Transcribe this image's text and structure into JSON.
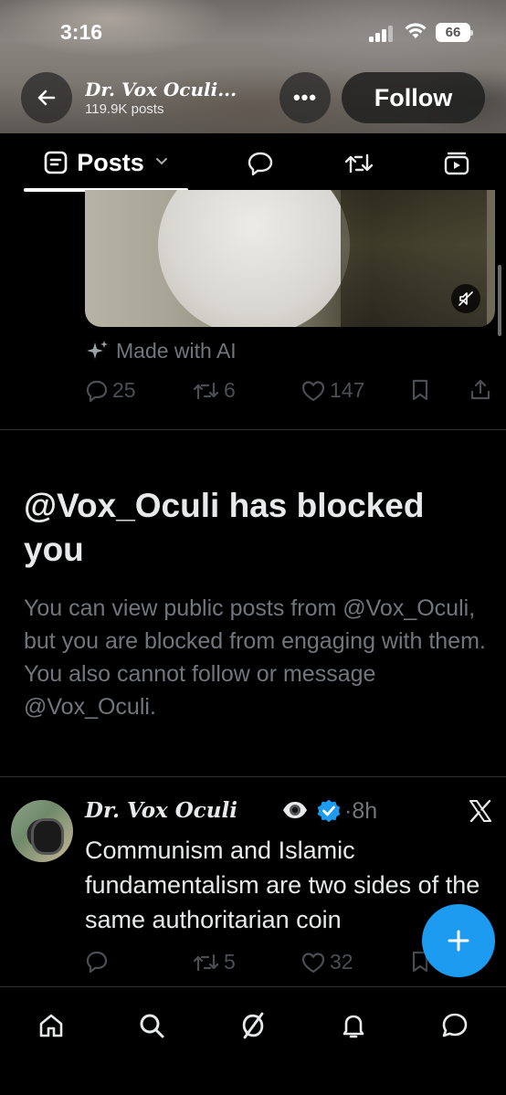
{
  "status_bar": {
    "time": "3:16",
    "battery": "66"
  },
  "header": {
    "profile_name": "Dr. Vox Oculi...",
    "posts_count": "119.9K posts",
    "follow_label": "Follow",
    "more_label": "•••"
  },
  "tabs": {
    "posts_label": "Posts",
    "icons": [
      "replies-icon",
      "reposts-icon",
      "media-icon"
    ]
  },
  "prev_post": {
    "ai_label": "Made with AI",
    "replies": "25",
    "reposts": "6",
    "likes": "147"
  },
  "blocked": {
    "title": "@Vox_Oculi has blocked you",
    "description": "You can view public posts from @Vox_Oculi, but you are blocked from engaging with them. You also cannot follow or message @Vox_Oculi."
  },
  "tweet": {
    "name": "Dr. Vox Oculi",
    "time": "·8h",
    "text": "Communism and Islamic fundamentalism are two sides of the same authoritarian coin",
    "replies": "",
    "reposts": "5",
    "likes": "32"
  },
  "colors": {
    "accent": "#1d9bf0",
    "muted": "#71767b",
    "text": "#e7e9ea"
  },
  "bottom_nav": [
    "home-icon",
    "search-icon",
    "grok-icon",
    "notifications-icon",
    "messages-icon"
  ]
}
